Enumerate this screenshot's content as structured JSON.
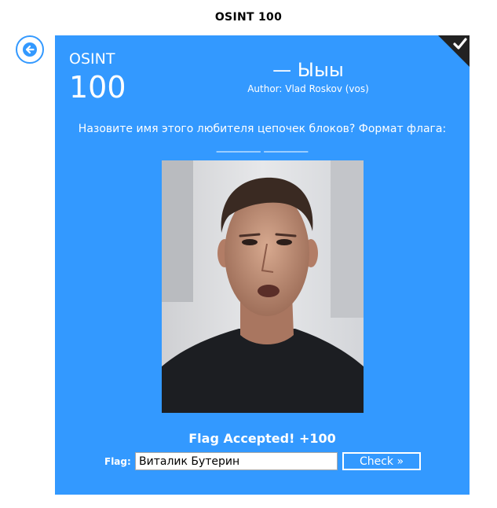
{
  "page": {
    "title": "OSINT 100"
  },
  "icons": {
    "back": "arrow-left-circle-icon",
    "solved": "checkmark-icon"
  },
  "colors": {
    "card_background": "#3399ff",
    "solved_corner": "#222222",
    "text": "#ffffff"
  },
  "task": {
    "category": "OSINT",
    "points": "100",
    "title": "— Ыыы",
    "author": "Author: Vlad Roskov (vos)",
    "description_line1": "Назовите имя этого любителя цепочек блоков? Формат флага:",
    "description_line2": "________ ________",
    "image_alt": "photo of a young man in a dark t-shirt",
    "solved": true
  },
  "submission": {
    "status": "Flag Accepted! +100",
    "flag_label": "Flag:",
    "flag_value": "Виталик Бутерин",
    "check_label": "Check »"
  }
}
